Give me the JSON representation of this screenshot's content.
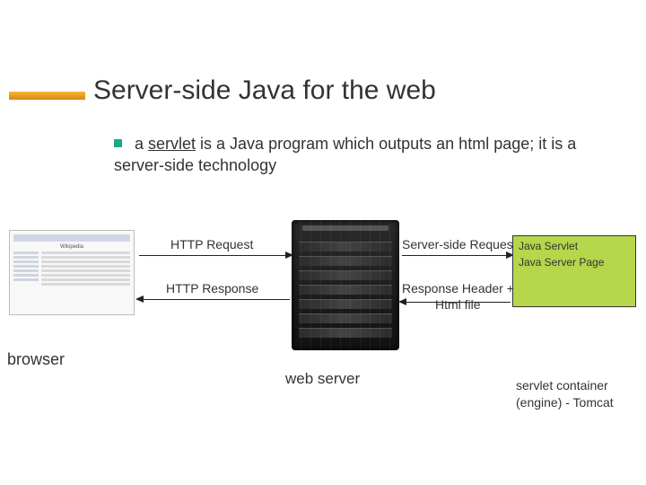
{
  "title": "Server-side Java for the web",
  "bullet": {
    "pre": "a ",
    "term": "servlet",
    "post": " is a Java program which outputs an html page; it is a server-side technology"
  },
  "labels": {
    "browser": "browser",
    "webserver": "web server",
    "httpRequest": "HTTP Request",
    "httpResponse": "HTTP Response",
    "ssRequest": "Server-side Request",
    "respHeader": "Response Header +",
    "htmlFile": "Html file"
  },
  "container": {
    "items": [
      "Java Servlet",
      "Java Server Page"
    ],
    "caption": "servlet container (engine) - Tomcat"
  },
  "browserThumb": {
    "siteName": "Wikipedia"
  }
}
